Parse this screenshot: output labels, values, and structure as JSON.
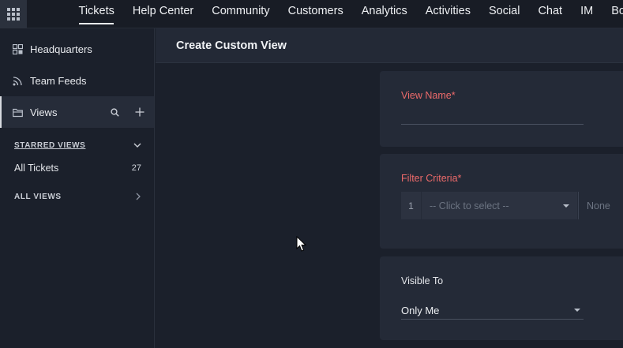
{
  "topnav": {
    "tabs": [
      {
        "label": "Tickets"
      },
      {
        "label": "Help Center"
      },
      {
        "label": "Community"
      },
      {
        "label": "Customers"
      },
      {
        "label": "Analytics"
      },
      {
        "label": "Activities"
      },
      {
        "label": "Social"
      },
      {
        "label": "Chat"
      },
      {
        "label": "IM"
      },
      {
        "label": "Bo"
      }
    ],
    "active_tab": "Tickets"
  },
  "sidebar": {
    "items": [
      {
        "label": "Headquarters",
        "icon": "grid-icon"
      },
      {
        "label": "Team Feeds",
        "icon": "feed-icon"
      },
      {
        "label": "Views",
        "icon": "folder-icon"
      }
    ],
    "starred_views": {
      "heading": "STARRED VIEWS",
      "items": [
        {
          "label": "All Tickets",
          "count": "27"
        }
      ]
    },
    "all_views": {
      "heading": "ALL VIEWS"
    }
  },
  "main": {
    "title": "Create Custom View",
    "view_name": {
      "label": "View Name",
      "required_mark": "*",
      "value": ""
    },
    "filter_criteria": {
      "label": "Filter Criteria",
      "required_mark": "*",
      "row_number": "1",
      "select_placeholder": "-- Click to select --",
      "value_placeholder": "None"
    },
    "visible_to": {
      "label": "Visible To",
      "value": "Only Me"
    }
  },
  "colors": {
    "background": "#1b202b",
    "required_label": "#ec6a6a",
    "card": "#242a37",
    "header": "#232936"
  }
}
